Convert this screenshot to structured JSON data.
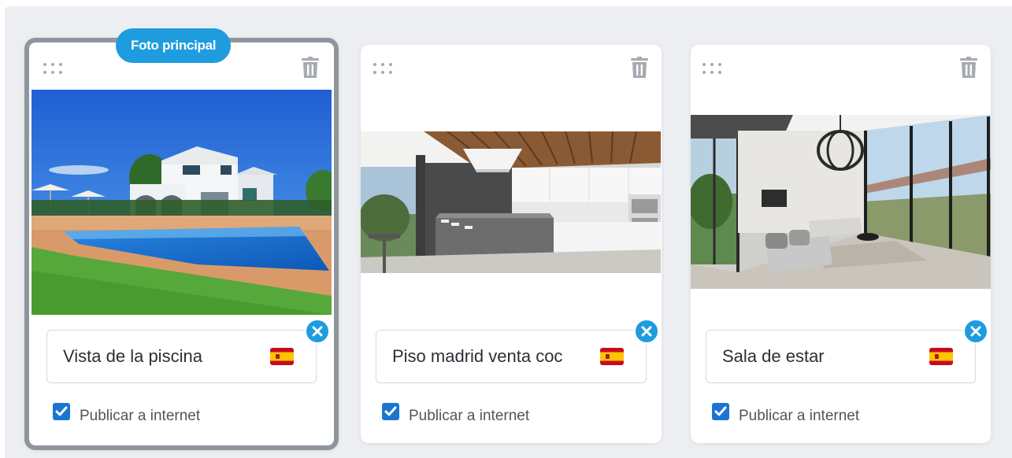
{
  "main_badge": "Foto principal",
  "colors": {
    "accent": "#1e9cdf",
    "checkbox": "#1b75d0",
    "main_border": "#8f959e",
    "panel_bg": "#eceef2"
  },
  "icons": {
    "drag": "drag-handle-icon",
    "delete": "trash-icon",
    "clear": "clear-x-icon",
    "language": "spain-flag-icon",
    "checked": "checkbox-checked-icon"
  },
  "cards": [
    {
      "title": "Vista de la piscina",
      "photo": "pool-villa-photo",
      "publish_label": "Publicar a internet",
      "publish_checked": true,
      "main": true
    },
    {
      "title": "Piso madrid venta coc",
      "photo": "kitchen-photo",
      "publish_label": "Publicar a internet",
      "publish_checked": true,
      "main": false
    },
    {
      "title": "Sala de estar",
      "photo": "living-room-photo",
      "publish_label": "Publicar a internet",
      "publish_checked": true,
      "main": false
    }
  ]
}
